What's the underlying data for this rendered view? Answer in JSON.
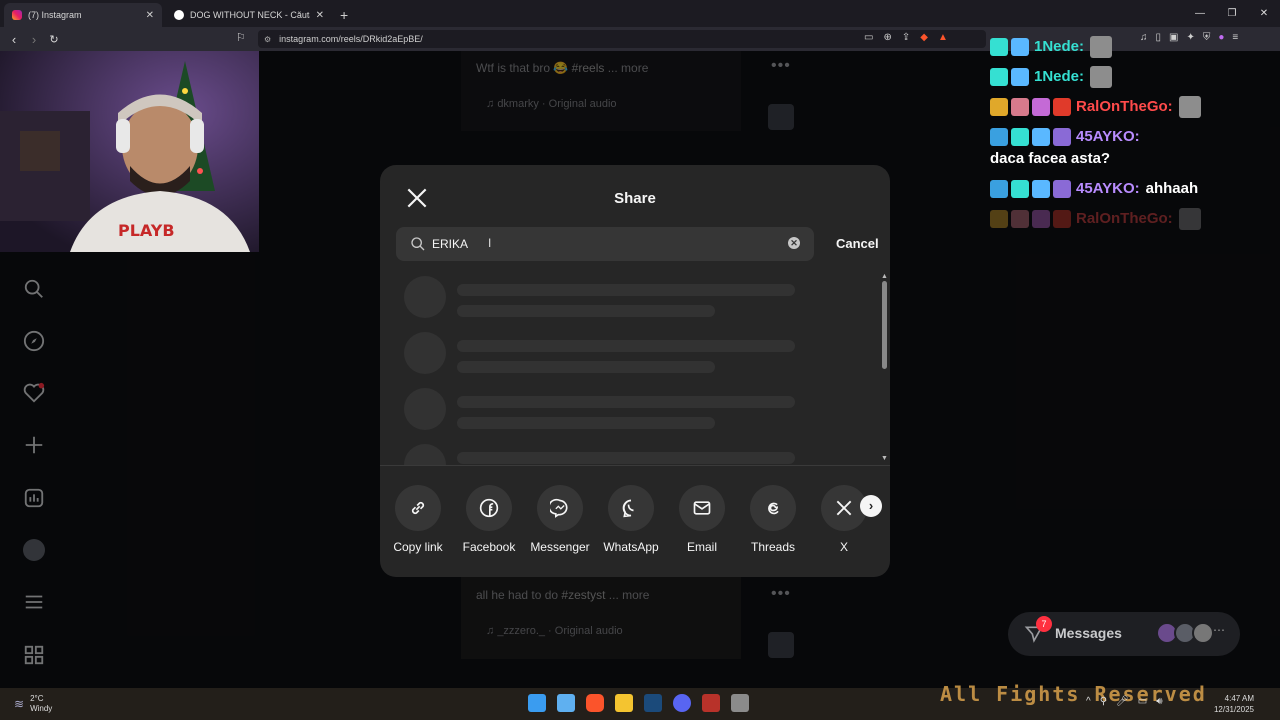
{
  "browser": {
    "tabs": [
      {
        "label": "(7) Instagram",
        "active": true
      },
      {
        "label": "DOG WITHOUT NECK - Căutare Goo",
        "active": false
      }
    ],
    "url": "instagram.com/reels/DRkid2aEpBE/",
    "icons": [
      "back-icon",
      "forward-icon",
      "reload-icon",
      "bookmark-icon",
      "brave-shield-icon"
    ]
  },
  "feed": {
    "top_caption": "Wtf is that bro",
    "top_caption_emoji": "😂",
    "top_hashtag": "#reels",
    "top_more": "... more",
    "top_audio": "dkmarky · Original audio",
    "bottom_caption": "all he had to do",
    "bottom_hashtag": "#zestyst",
    "bottom_more": "... more",
    "bottom_audio": "_zzzero._ · Original audio"
  },
  "share_modal": {
    "title": "Share",
    "search_value": "ERIKA",
    "cancel_label": "Cancel",
    "targets": [
      {
        "label": "Copy link",
        "icon": "link-icon"
      },
      {
        "label": "Facebook",
        "icon": "facebook-icon"
      },
      {
        "label": "Messenger",
        "icon": "messenger-icon"
      },
      {
        "label": "WhatsApp",
        "icon": "whatsapp-icon"
      },
      {
        "label": "Email",
        "icon": "email-icon"
      },
      {
        "label": "Threads",
        "icon": "threads-icon"
      },
      {
        "label": "X",
        "icon": "x-icon"
      }
    ]
  },
  "chat": [
    {
      "user": "1Nede:",
      "color": "#35e0d2",
      "message": "",
      "faded": false
    },
    {
      "user": "1Nede:",
      "color": "#35e0d2",
      "message": "",
      "faded": false
    },
    {
      "user": "RalOnTheGo:",
      "color": "#ff4b4b",
      "message": "",
      "faded": false
    },
    {
      "user": "45AYKO:",
      "color": "#b98cff",
      "message": "daca facea asta?",
      "faded": false
    },
    {
      "user": "45AYKO:",
      "color": "#b98cff",
      "message": "ahhaah",
      "faded": false
    },
    {
      "user": "RalOnTheGo:",
      "color": "#ff4b4b",
      "message": "",
      "faded": true
    }
  ],
  "messages": {
    "label": "Messages",
    "badge": "7"
  },
  "taskbar": {
    "temperature": "2°C",
    "condition": "Windy",
    "time": "4:47 AM",
    "date": "12/31/2025",
    "stream_banner": "All Fights Reserved"
  },
  "colors": {
    "modal_bg": "#262626",
    "page_bg": "#0e0f13",
    "accent_red": "#ff3040"
  }
}
